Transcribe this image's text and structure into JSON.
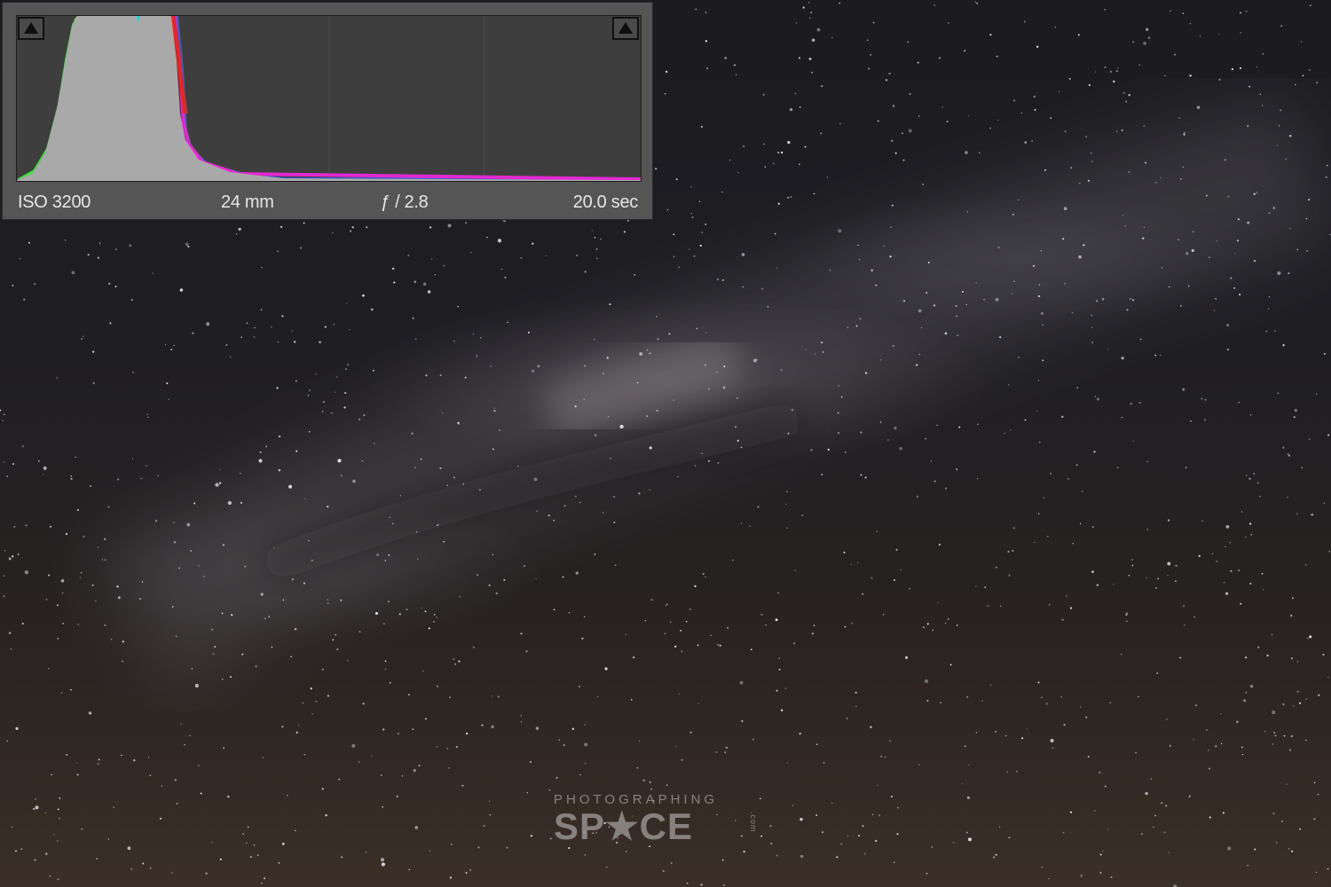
{
  "exif": {
    "iso": "ISO 3200",
    "focal_length": "24 mm",
    "aperture": "ƒ / 2.8",
    "shutter": "20.0 sec"
  },
  "histogram": {
    "clip_left_icon": "shadow-clipping-triangle-icon",
    "clip_right_icon": "highlight-clipping-triangle-icon",
    "colors": {
      "fill": "#a9a9a9",
      "red": "#e0282a",
      "green": "#4bd84b",
      "blue": "#3a5ad6",
      "yellow": "#e6d83a",
      "magenta": "#e02ad0",
      "cyan": "#2ad0d8"
    }
  },
  "watermark": {
    "top_text": "PHOTOGRAPHING",
    "main_text": "SP★CE",
    "suffix": ".com"
  }
}
